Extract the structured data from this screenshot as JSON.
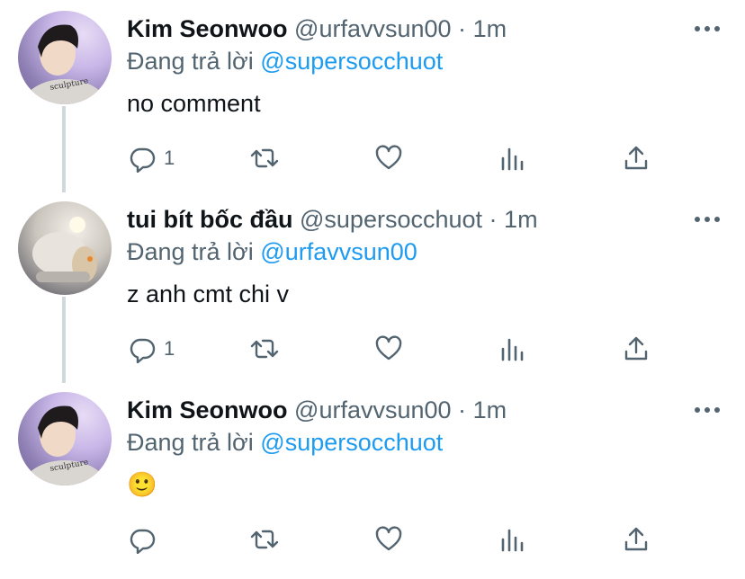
{
  "tweets": [
    {
      "name": "Kim Seonwoo",
      "handle": "@urfavvsun00",
      "dot": "·",
      "time": "1m",
      "reply_prefix": "Đang trả lời",
      "reply_mention": "@supersocchuot",
      "text": "no comment",
      "reply_count": "1",
      "avatar_shirt_text": "sculpture"
    },
    {
      "name": "tui bít bốc đầu",
      "handle": "@supersocchuot",
      "dot": "·",
      "time": "1m",
      "reply_prefix": "Đang trả lời",
      "reply_mention": "@urfavvsun00",
      "text": "z anh cmt chi v",
      "reply_count": "1"
    },
    {
      "name": "Kim Seonwoo",
      "handle": "@urfavvsun00",
      "dot": "·",
      "time": "1m",
      "reply_prefix": "Đang trả lời",
      "reply_mention": "@supersocchuot",
      "text": "🙂",
      "reply_count": "",
      "avatar_shirt_text": "sculpture"
    }
  ],
  "icons": {
    "reply": "reply-icon",
    "retweet": "retweet-icon",
    "like": "heart-icon",
    "stats": "stats-icon",
    "share": "share-icon",
    "more": "more-icon"
  },
  "colors": {
    "text": "#0f1419",
    "secondary": "#536471",
    "mention": "#1d9bf0",
    "thread_line": "#cfd9de"
  }
}
